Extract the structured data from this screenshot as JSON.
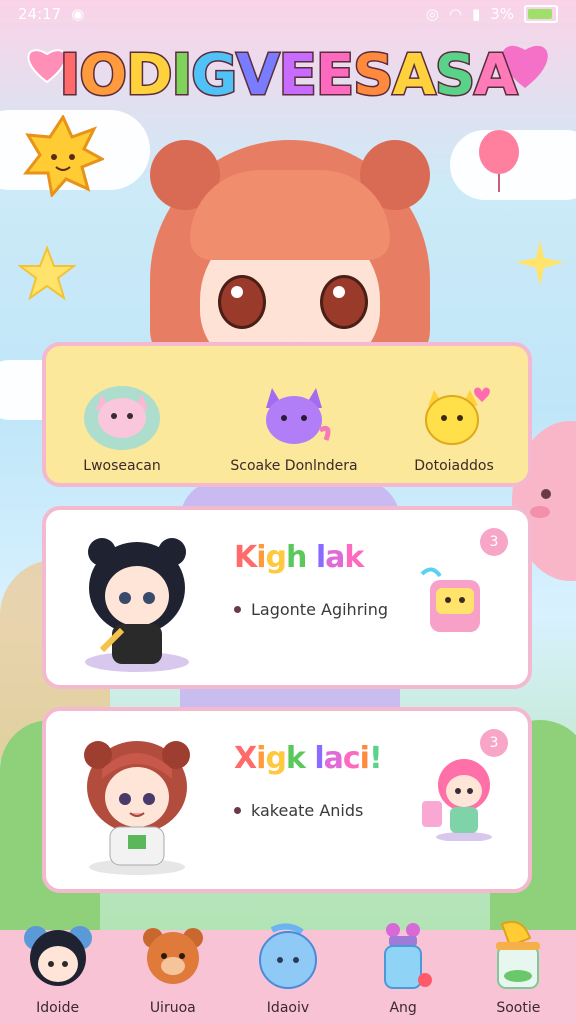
{
  "status": {
    "time": "24:17",
    "battery": "3%"
  },
  "title": {
    "letters": [
      "I",
      "O",
      "D",
      "I",
      "G",
      "V",
      "E",
      "E",
      "S",
      "A",
      "S",
      "A"
    ],
    "colors": [
      "#ff6a6a",
      "#ff9a3d",
      "#ffd23d",
      "#7fd35a",
      "#4fc3f7",
      "#7a7cff",
      "#c86bff",
      "#ff6ac1",
      "#ff8a3d",
      "#ffd23d",
      "#5ad38a",
      "#ff7ab8"
    ]
  },
  "pets": [
    {
      "label": "Lwoseacan",
      "icon": "pink-cat-icon"
    },
    {
      "label": "Scoake Donlndera",
      "icon": "purple-cat-icon"
    },
    {
      "label": "Dotoiaddos",
      "icon": "yellow-cat-icon"
    }
  ],
  "cards": [
    {
      "title": "Kigh lak",
      "sub": "Lagonte Agihring",
      "badge": "3"
    },
    {
      "title": "Xigk laci!",
      "sub": "kakeate Anids",
      "badge": "3"
    }
  ],
  "nav": [
    {
      "label": "Idoide",
      "icon": "panda-girl-icon"
    },
    {
      "label": "Uiruoa",
      "icon": "bear-icon"
    },
    {
      "label": "Idaoiv",
      "icon": "blue-slime-icon"
    },
    {
      "label": "Ang",
      "icon": "bottle-icon"
    },
    {
      "label": "Sootie",
      "icon": "jar-icon"
    }
  ]
}
